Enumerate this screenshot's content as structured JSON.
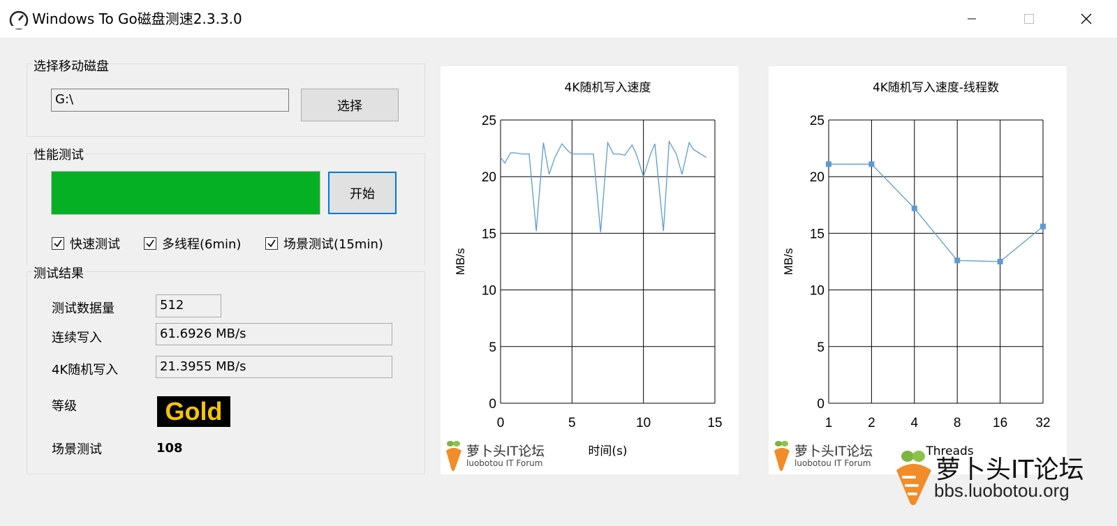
{
  "window": {
    "title": "Windows To Go磁盘测速2.3.3.0",
    "icon": "speedometer-icon"
  },
  "disk_group": {
    "label": "选择移动磁盘",
    "path_value": "G:\\",
    "select_button": "选择"
  },
  "perf_group": {
    "label": "性能测试",
    "progress": 1.0,
    "progress_color": "#06b025",
    "start_button": "开始",
    "options": [
      {
        "label": "快速测试",
        "checked": true
      },
      {
        "label": "多线程(6min)",
        "checked": true
      },
      {
        "label": "场景测试(15min)",
        "checked": true
      }
    ]
  },
  "result_group": {
    "label": "测试结果",
    "data_size_label": "测试数据量",
    "data_size_value": "512",
    "seq_write_label": "连续写入",
    "seq_write_value": "61.6926 MB/s",
    "rand4k_label": "4K随机写入",
    "rand4k_value": "21.3955 MB/s",
    "grade_label": "等级",
    "grade_value": "Gold",
    "grade_color": "#f5c400",
    "scene_label": "场景测试",
    "scene_value": "108"
  },
  "chart_data": [
    {
      "type": "line",
      "title": "4K随机写入速度",
      "xlabel": "时间(s)",
      "ylabel": "MB/s",
      "xlim": [
        0,
        15
      ],
      "ylim": [
        0,
        25
      ],
      "xticks": [
        0,
        5,
        10,
        15
      ],
      "yticks": [
        0,
        5,
        10,
        15,
        20,
        25
      ],
      "grid": true,
      "color": "#5b9bd5",
      "x": [
        0,
        0.3,
        0.7,
        1.0,
        1.5,
        2.0,
        2.5,
        3.0,
        3.4,
        3.8,
        4.3,
        4.7,
        5.0,
        5.5,
        6.0,
        6.5,
        7.0,
        7.5,
        7.9,
        8.3,
        8.7,
        9.2,
        9.5,
        10.0,
        10.5,
        10.8,
        11.4,
        11.8,
        12.3,
        12.7,
        13.2,
        13.5,
        14.0,
        14.4
      ],
      "values": [
        21.7,
        21.2,
        22.1,
        22.1,
        22.0,
        22.0,
        15.2,
        23.0,
        20.2,
        21.7,
        22.9,
        22.3,
        22.0,
        22.0,
        22.0,
        22.0,
        15.1,
        23.0,
        22.0,
        22.0,
        21.9,
        22.8,
        22.0,
        20.0,
        22.0,
        22.9,
        15.2,
        23.1,
        22.0,
        20.2,
        23.0,
        22.4,
        22.0,
        21.7
      ]
    },
    {
      "type": "line",
      "title": "4K随机写入速度-线程数",
      "xlabel": "Threads",
      "ylabel": "MB/s",
      "ylim": [
        0,
        25
      ],
      "yticks": [
        0,
        5,
        10,
        15,
        20,
        25
      ],
      "categories": [
        "1",
        "2",
        "4",
        "8",
        "16",
        "32"
      ],
      "values": [
        21.1,
        21.1,
        17.2,
        12.6,
        12.5,
        15.6
      ],
      "grid": true,
      "color": "#5b9bd5",
      "marker": "square"
    }
  ],
  "watermarks": {
    "forum_cn": "萝卜头IT论坛",
    "forum_en": "luobotou IT Forum",
    "site_cn": "萝卜头IT论坛",
    "site_url": "bbs.luobotou.org"
  }
}
